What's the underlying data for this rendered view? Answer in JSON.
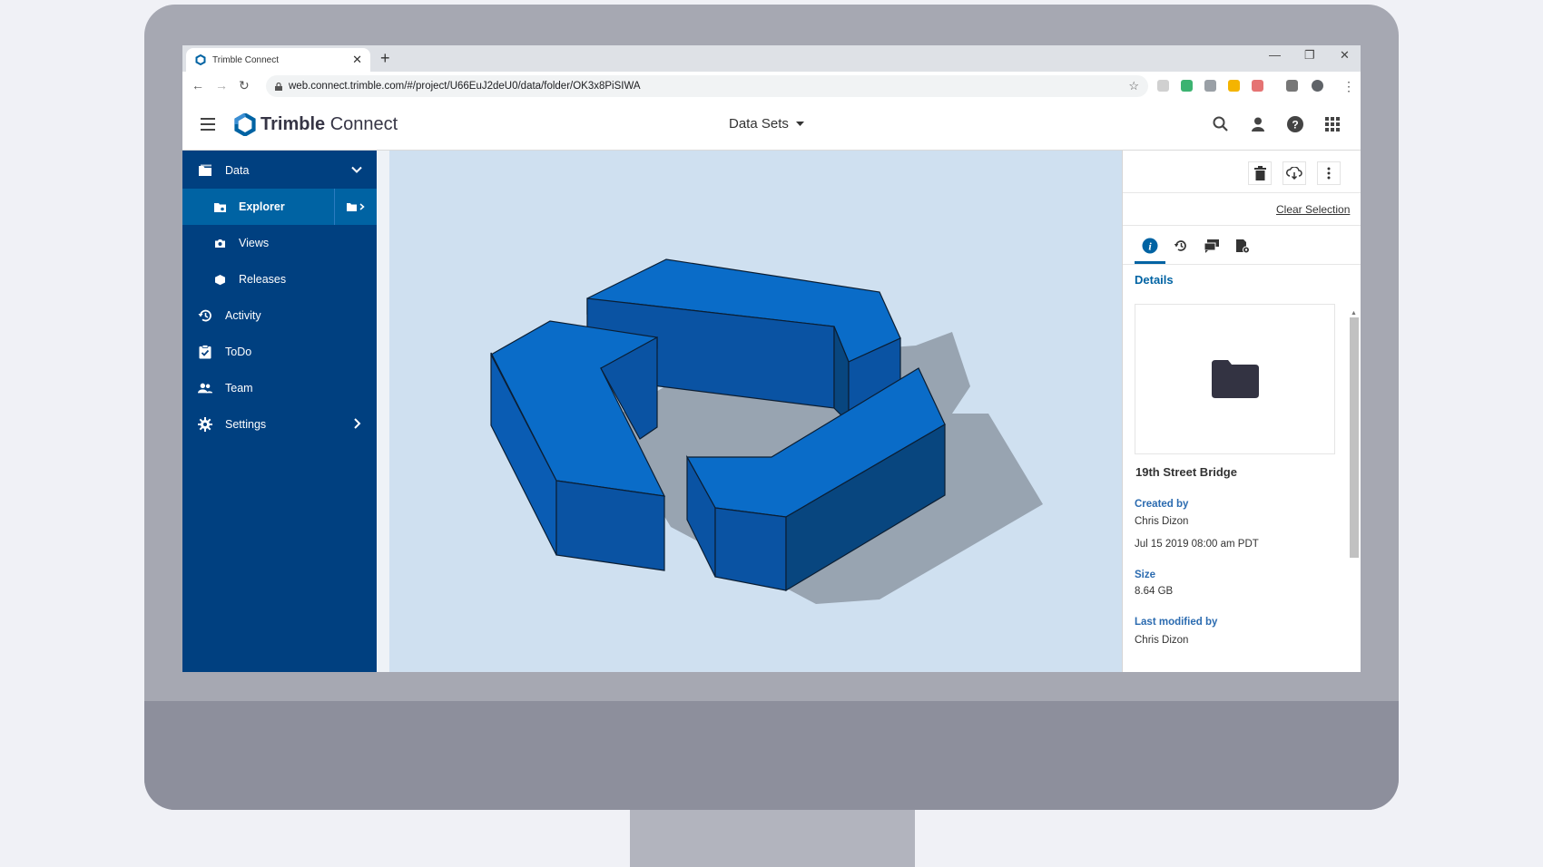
{
  "browser": {
    "tab_title": "Trimble Connect",
    "url": "web.connect.trimble.com/#/project/U66EuJ2deU0/data/folder/OK3x8PiSIWA"
  },
  "app": {
    "brand_bold": "Trimble",
    "brand_light": " Connect",
    "dataset_selector": "Data Sets"
  },
  "sidebar": {
    "items": [
      {
        "label": "Data",
        "icon": "folder-icon"
      },
      {
        "label": "Explorer",
        "icon": "explorer-icon"
      },
      {
        "label": "Views",
        "icon": "camera-icon"
      },
      {
        "label": "Releases",
        "icon": "package-icon"
      },
      {
        "label": "Activity",
        "icon": "history-icon"
      },
      {
        "label": "ToDo",
        "icon": "clipboard-check-icon"
      },
      {
        "label": "Team",
        "icon": "team-icon"
      },
      {
        "label": "Settings",
        "icon": "gear-icon"
      }
    ]
  },
  "panel": {
    "clear_selection": "Clear Selection",
    "details_title": "Details",
    "file_name": "19th Street Bridge",
    "created_by_label": "Created by",
    "created_by": "Chris Dizon",
    "created_date": "Jul 15 2019 08:00 am PDT",
    "size_label": "Size",
    "size": "8.64 GB",
    "modified_by_label": "Last modified by",
    "modified_by": "Chris Dizon"
  },
  "colors": {
    "sidebar_bg": "#004080",
    "sidebar_active": "#0063a3",
    "model_blue": "#0a6cc8",
    "viewport_bg": "#cfe0f0"
  }
}
